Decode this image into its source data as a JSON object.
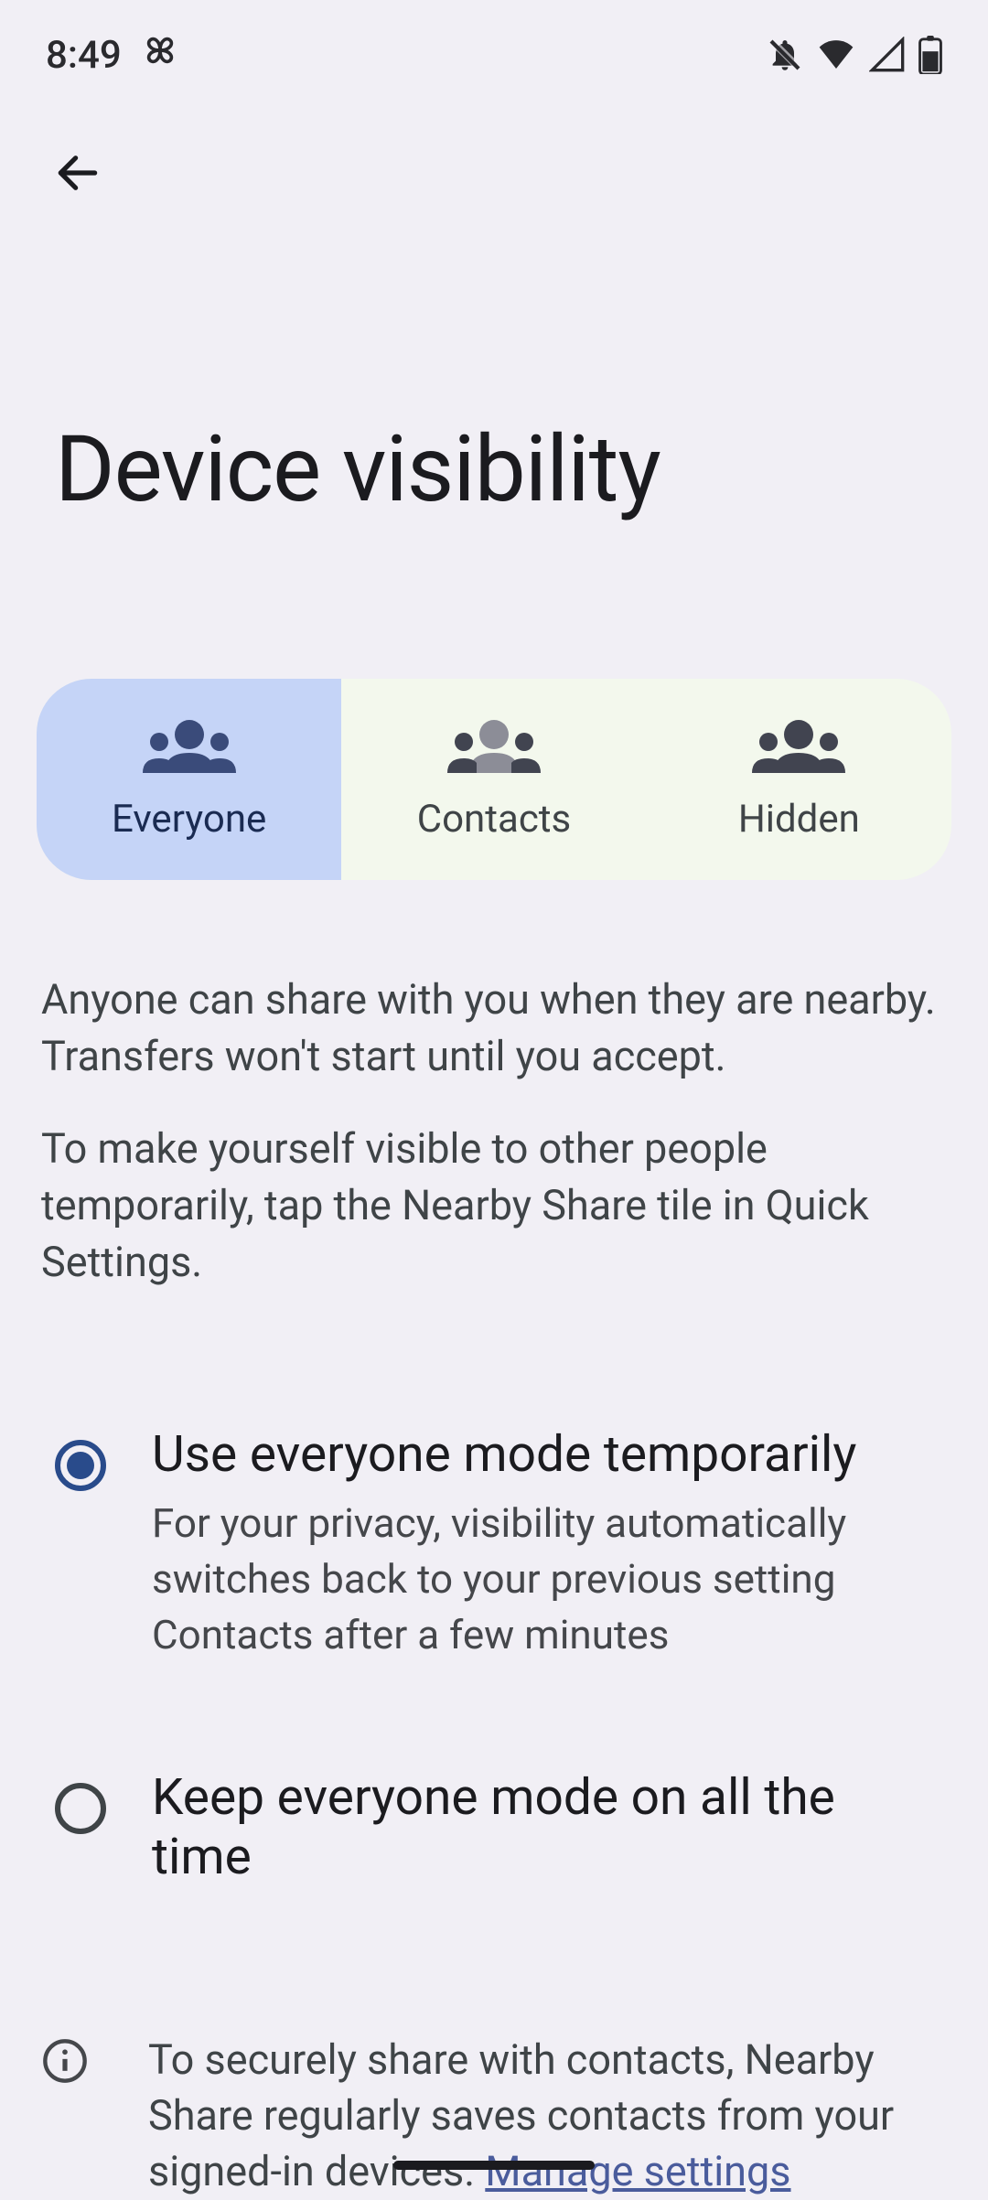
{
  "status": {
    "time": "8:49"
  },
  "title": "Device visibility",
  "segments": {
    "everyone": "Everyone",
    "contacts": "Contacts",
    "hidden": "Hidden"
  },
  "description": {
    "p1": "Anyone can share with you when they are nearby. Transfers won't start until you accept.",
    "p2": "To make yourself visible to other people temporarily, tap the Nearby Share tile in Quick Settings."
  },
  "options": {
    "temp": {
      "label": "Use everyone mode temporarily",
      "sub": "For your privacy, visibility automatically switches back to your previous setting Contacts after a few minutes"
    },
    "always": {
      "label": "Keep everyone mode on all the time"
    }
  },
  "info": {
    "text": "To securely share with contacts, Nearby Share regularly saves contacts from your signed-in devices. ",
    "link": "Manage settings"
  }
}
